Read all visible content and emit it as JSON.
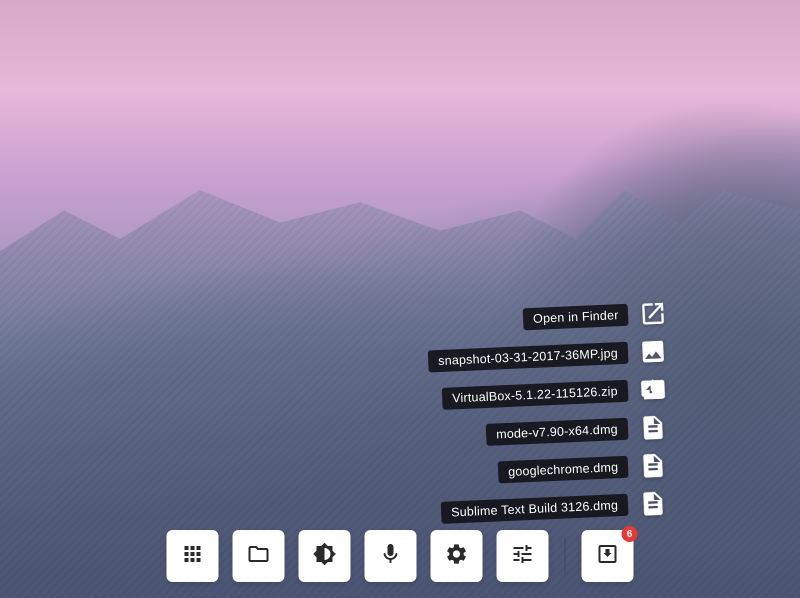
{
  "downloads": {
    "items": [
      {
        "label": "Open in Finder",
        "icon": "open-external"
      },
      {
        "label": "snapshot-03-31-2017-36MP.jpg",
        "icon": "image"
      },
      {
        "label": "VirtualBox-5.1.22-115126.zip",
        "icon": "archive"
      },
      {
        "label": "mode-v7.90-x64.dmg",
        "icon": "file"
      },
      {
        "label": "googlechrome.dmg",
        "icon": "file"
      },
      {
        "label": "Sublime Text Build 3126.dmg",
        "icon": "file"
      }
    ],
    "badge_count": "6"
  },
  "dock": {
    "items": [
      {
        "name": "apps-grid",
        "icon": "grid"
      },
      {
        "name": "files",
        "icon": "folder"
      },
      {
        "name": "brightness",
        "icon": "brightness"
      },
      {
        "name": "microphone",
        "icon": "mic"
      },
      {
        "name": "settings",
        "icon": "gear"
      },
      {
        "name": "equalizer",
        "icon": "sliders"
      }
    ],
    "downloads_name": "downloads"
  }
}
